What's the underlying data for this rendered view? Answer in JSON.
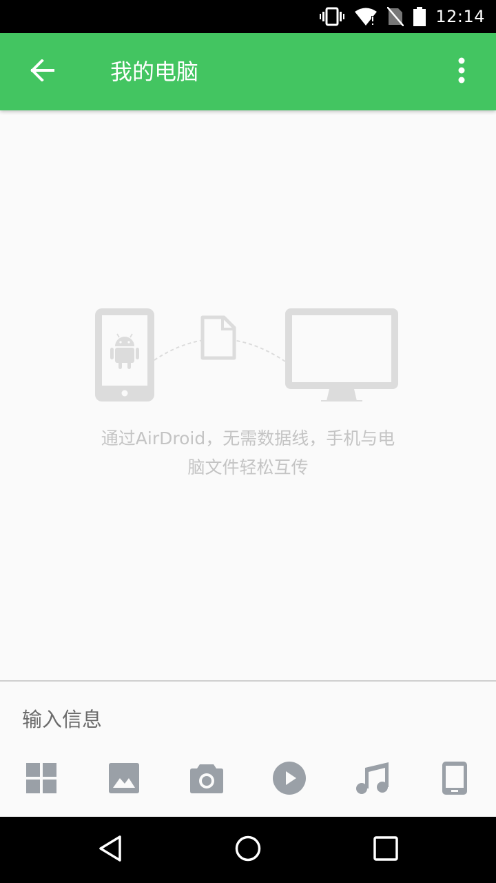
{
  "status_bar": {
    "time": "12:14",
    "icons": [
      "vibrate-icon",
      "wifi-icon",
      "no-sim-icon",
      "battery-icon"
    ]
  },
  "app_bar": {
    "title": "我的电脑",
    "back_icon": "arrow-left-icon",
    "menu_icon": "more-vert-icon",
    "color": "#43c561"
  },
  "main": {
    "hint_line1": "通过AirDroid，无需数据线，手机与电",
    "hint_line2": "脑文件轻松互传"
  },
  "input": {
    "placeholder": "输入信息"
  },
  "toolbar": {
    "buttons": [
      "apps-icon",
      "image-icon",
      "camera-icon",
      "video-icon",
      "music-icon",
      "phone-icon"
    ]
  },
  "nav_bar": {
    "buttons": [
      "back-icon",
      "home-icon",
      "recents-icon"
    ]
  }
}
